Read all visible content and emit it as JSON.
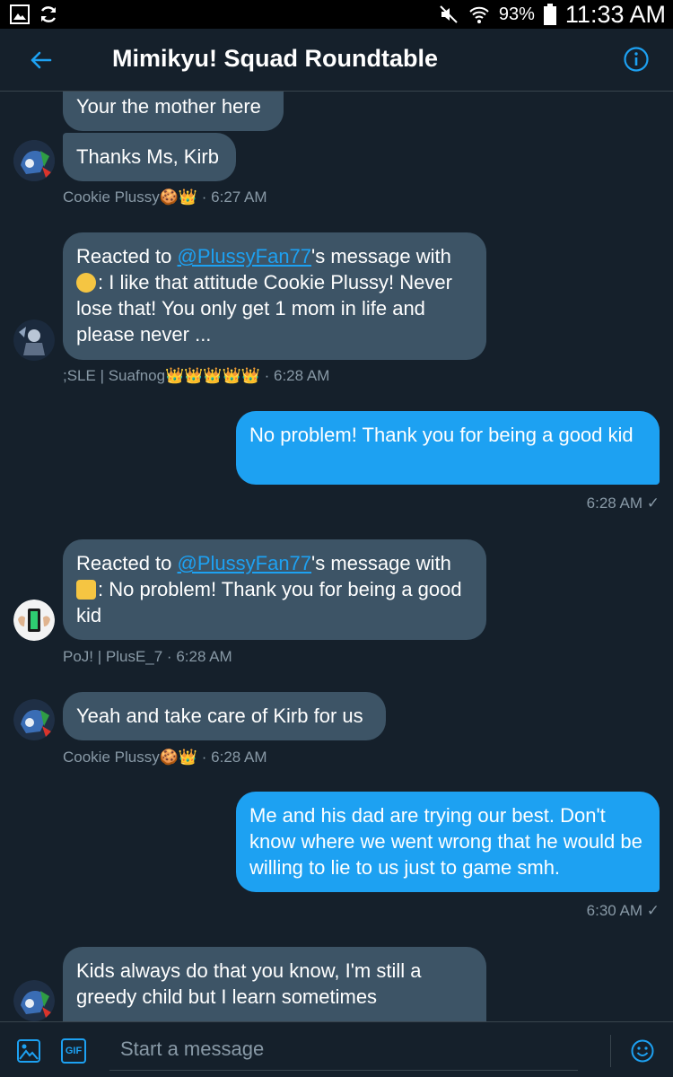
{
  "status_bar": {
    "battery": "93%",
    "time": "11:33 AM"
  },
  "header": {
    "title": "Mimikyu! Squad Roundtable"
  },
  "messages": [
    {
      "text": "Your the mother here"
    },
    {
      "text": "Thanks Ms, Kirb",
      "sender": "Cookie Plussy🍪👑",
      "time": "6:27 AM"
    },
    {
      "prefix": "Reacted to ",
      "mention": "@PlussyFan77",
      "suffix": "'s message with",
      "body": ": I like that attitude Cookie Plussy! Never lose that! You only get 1 mom in life and please never ...",
      "sender": ";SLE | Suafnog👑👑👑👑👑",
      "time": "6:28 AM"
    },
    {
      "text": "No problem! Thank you for being a good kid",
      "time": "6:28 AM ✓"
    },
    {
      "prefix": "Reacted to ",
      "mention": "@PlussyFan77",
      "suffix": "'s message with",
      "body": ": No problem! Thank you for being a good kid",
      "sender": "PoJ! | PlusE_7",
      "time": "6:28 AM"
    },
    {
      "text": "Yeah and take care of Kirb for us",
      "sender": "Cookie Plussy🍪👑",
      "time": "6:28 AM"
    },
    {
      "text": "Me and his dad are trying our best. Don't know where we went wrong that he would be willing to lie to us just to game smh.",
      "time": "6:30 AM ✓"
    },
    {
      "text": "Kids always do that you know, I'm still a greedy child but I learn sometimes"
    }
  ],
  "composer": {
    "placeholder": "Start a message",
    "gif_label": "GIF"
  },
  "colors": {
    "background": "#15202b",
    "incoming": "#3d5466",
    "outgoing": "#1da1f2",
    "accent": "#1da1f2",
    "muted": "#8899a6"
  },
  "icons": [
    "image-icon",
    "sync-icon",
    "mute-icon",
    "wifi-icon",
    "battery-icon",
    "back-arrow-icon",
    "info-icon",
    "gif-icon",
    "smiley-icon"
  ]
}
